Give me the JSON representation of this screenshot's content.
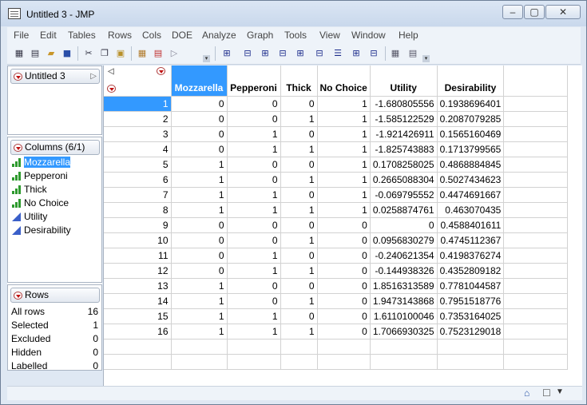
{
  "window": {
    "title": "Untitled 3 - JMP",
    "minimize": "–",
    "maximize": "▢",
    "close": "✕"
  },
  "menus": [
    "File",
    "Edit",
    "Tables",
    "Rows",
    "Cols",
    "DOE",
    "Analyze",
    "Graph",
    "Tools",
    "View",
    "Window",
    "Help"
  ],
  "table_panel": {
    "name": "Untitled 3"
  },
  "columns_panel": {
    "header": "Columns (6/1)",
    "items": [
      {
        "name": "Mozzarella",
        "type": "nominal"
      },
      {
        "name": "Pepperoni",
        "type": "nominal"
      },
      {
        "name": "Thick",
        "type": "nominal"
      },
      {
        "name": "No Choice",
        "type": "nominal"
      },
      {
        "name": "Utility",
        "type": "continuous"
      },
      {
        "name": "Desirability",
        "type": "continuous"
      }
    ],
    "selected": "Mozzarella"
  },
  "rows_panel": {
    "header": "Rows",
    "items": [
      {
        "label": "All rows",
        "value": "16"
      },
      {
        "label": "Selected",
        "value": "1"
      },
      {
        "label": "Excluded",
        "value": "0"
      },
      {
        "label": "Hidden",
        "value": "0"
      },
      {
        "label": "Labelled",
        "value": "0"
      }
    ]
  },
  "grid": {
    "headers": [
      "Mozzarella",
      "Pepperoni",
      "Thick",
      "No Choice",
      "Utility",
      "Desirability"
    ],
    "selected_column": "Mozzarella",
    "selected_row": 1,
    "rows": [
      [
        "1",
        "0",
        "0",
        "0",
        "1",
        "-1.680805556",
        "0.1938696401"
      ],
      [
        "2",
        "0",
        "0",
        "1",
        "1",
        "-1.585122529",
        "0.2087079285"
      ],
      [
        "3",
        "0",
        "1",
        "0",
        "1",
        "-1.921426911",
        "0.1565160469"
      ],
      [
        "4",
        "0",
        "1",
        "1",
        "1",
        "-1.825743883",
        "0.1713799565"
      ],
      [
        "5",
        "1",
        "0",
        "0",
        "1",
        "0.1708258025",
        "0.4868884845"
      ],
      [
        "6",
        "1",
        "0",
        "1",
        "1",
        "0.2665088304",
        "0.5027434623"
      ],
      [
        "7",
        "1",
        "1",
        "0",
        "1",
        "-0.069795552",
        "0.4474691667"
      ],
      [
        "8",
        "1",
        "1",
        "1",
        "1",
        "0.0258874761",
        "0.463070435"
      ],
      [
        "9",
        "0",
        "0",
        "0",
        "0",
        "0",
        "0.4588401611"
      ],
      [
        "10",
        "0",
        "0",
        "1",
        "0",
        "0.0956830279",
        "0.4745112367"
      ],
      [
        "11",
        "0",
        "1",
        "0",
        "0",
        "-0.240621354",
        "0.4198376274"
      ],
      [
        "12",
        "0",
        "1",
        "1",
        "0",
        "-0.144938326",
        "0.4352809182"
      ],
      [
        "13",
        "1",
        "0",
        "0",
        "0",
        "1.8516313589",
        "0.7781044587"
      ],
      [
        "14",
        "1",
        "0",
        "1",
        "0",
        "1.9473143868",
        "0.7951518776"
      ],
      [
        "15",
        "1",
        "1",
        "0",
        "0",
        "1.6110100046",
        "0.7353164025"
      ],
      [
        "16",
        "1",
        "1",
        "1",
        "0",
        "1.7066930325",
        "0.7523129018"
      ]
    ]
  },
  "colors": {
    "selection": "#3399ff",
    "nominal_icon": "#2e9a2e",
    "continuous_icon": "#3a5fc9",
    "red_triangle": "#c01010"
  }
}
